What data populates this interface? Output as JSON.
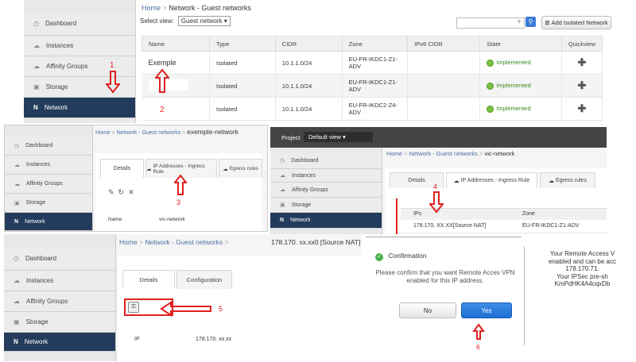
{
  "panel1": {
    "sidebar": [
      "Dashboard",
      "Instances",
      "Affinity Groups",
      "Storage",
      "Network"
    ],
    "breadcrumb": {
      "home": "Home",
      "sep": ">",
      "current": "Network - Guest networks"
    },
    "select_label": "Select view:",
    "select_value": "Guest network",
    "add_button": "Add Isolated Network",
    "columns": [
      "Name",
      "Type",
      "CIDR",
      "Zone",
      "IPv6 CIDR",
      "State",
      "Quickview"
    ],
    "rows": [
      {
        "name": "Exemple",
        "type": "Isolated",
        "cidr": "10.1.1.0/24",
        "zone": "EU-FR-IKDC1-Z1-ADV",
        "ipv6": "",
        "state": "Implemented"
      },
      {
        "name": "",
        "type": "Isolated",
        "cidr": "10.1.1.0/24",
        "zone": "EU-FR-IKDC1-Z1-ADV",
        "ipv6": "",
        "state": "Implemented"
      },
      {
        "name": "",
        "type": "Isolated",
        "cidr": "10.1.1.0/24",
        "zone": "EU-FR-IKDC2-Z4-ADV",
        "ipv6": "",
        "state": "Implemented"
      }
    ],
    "step1": "1",
    "step2": "2",
    "quick": "✚"
  },
  "panel2": {
    "sidebar": [
      "Dashboard",
      "Instances",
      "Affinity Groups",
      "Storage",
      "Network"
    ],
    "breadcrumb": {
      "home": "Home",
      "sep": ">",
      "mid": "Network - Guest networks",
      "current": "exemple-network"
    },
    "tabs": [
      "Details",
      "IP Addresses - Ingress Rule",
      "Egress rules"
    ],
    "name_label": "Name",
    "name_value": "vic-network",
    "step": "3"
  },
  "panel3": {
    "project_label": "Project",
    "project_value": "Default view",
    "sidebar": [
      "Dashboard",
      "Instances",
      "Affinity Groups",
      "Storage",
      "Network"
    ],
    "breadcrumb": {
      "home": "Home",
      "sep": ">",
      "mid": "Network - Guest networks",
      "current": "vic-network"
    },
    "tabs": [
      "Details",
      "IP Addresses - Ingress Rule",
      "Egress rules"
    ],
    "col_ips": "IPs",
    "col_zone": "Zone",
    "ip": "178.170.",
    "ip_suffix": "XX.XX[Source NAT]",
    "zone": "EU-FR-IKDC1-Z1-ADV",
    "step": "4"
  },
  "panel4": {
    "sidebar": [
      "Dashboard",
      "Instances",
      "Affinity Groups",
      "Storage",
      "Network"
    ],
    "breadcrumb": {
      "home": "Home",
      "sep": ">",
      "mid": "Network - Guest networks",
      "current": "178.170.",
      "current_suffix": "xx.xx0 [Source NAT]"
    },
    "tabs": [
      "Details",
      "Configuration"
    ],
    "ip_label": "IP",
    "ip_value": "178.170.",
    "ip_suffix": "xx.xx",
    "step": "5"
  },
  "dialog": {
    "title": "Confirmation",
    "message": "Please confirm that you want Remote Acces VPN enabled for this IP address.",
    "no": "No",
    "yes": "Yes",
    "step": "6"
  },
  "side_text": {
    "l1": "Your Remote Access V",
    "l2": "enabled and can be acc",
    "l3": "178.170.71.",
    "l4": "Your IPSec pre-sh",
    "l5": "KmPdHK4A4cqxDb"
  }
}
